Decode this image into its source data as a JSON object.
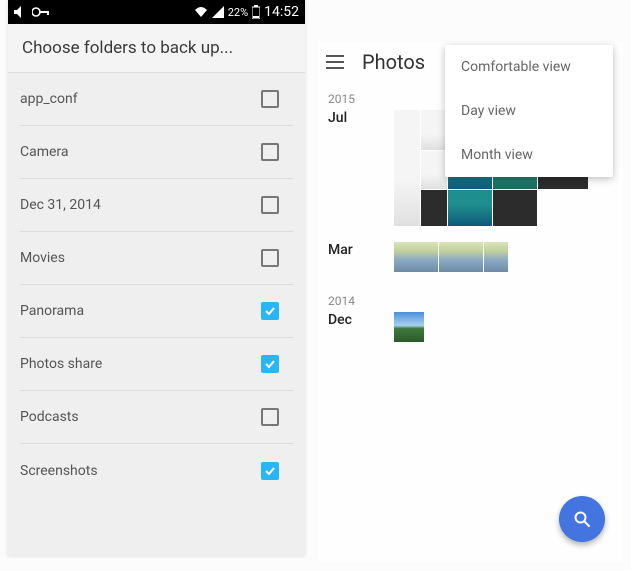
{
  "left": {
    "statusbar": {
      "battery_percent": "22%",
      "time": "14:52"
    },
    "header_title": "Choose folders to back up...",
    "folders": [
      {
        "label": "app_conf",
        "checked": false
      },
      {
        "label": "Camera",
        "checked": false
      },
      {
        "label": "Dec 31, 2014",
        "checked": false
      },
      {
        "label": "Movies",
        "checked": false
      },
      {
        "label": "Panorama",
        "checked": true
      },
      {
        "label": "Photos share",
        "checked": true
      },
      {
        "label": "Podcasts",
        "checked": false
      },
      {
        "label": "Screenshots",
        "checked": true
      }
    ]
  },
  "right": {
    "title": "Photos",
    "menu": [
      "Comfortable view",
      "Day view",
      "Month view"
    ],
    "sections": {
      "year_2015": "2015",
      "jul": "Jul",
      "mar": "Mar",
      "year_2014": "2014",
      "dec": "Dec"
    }
  }
}
